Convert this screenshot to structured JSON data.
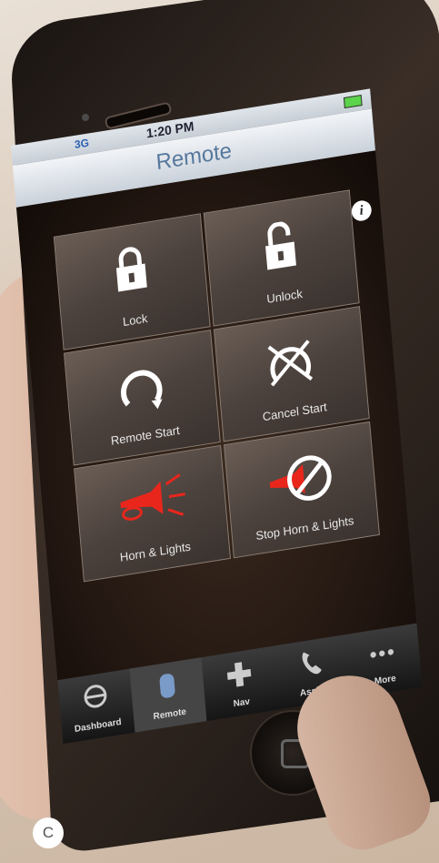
{
  "status": {
    "network": "3G",
    "time": "1:20 PM"
  },
  "nav": {
    "title": "Remote",
    "info_label": "i"
  },
  "tiles": [
    {
      "label": "Lock",
      "icon": "lock-icon"
    },
    {
      "label": "Unlock",
      "icon": "unlock-icon"
    },
    {
      "label": "Remote Start",
      "icon": "restart-arrow-icon"
    },
    {
      "label": "Cancel Start",
      "icon": "cancel-start-icon"
    },
    {
      "label": "Horn & Lights",
      "icon": "horn-icon"
    },
    {
      "label": "Stop Horn & Lights",
      "icon": "stop-horn-icon"
    }
  ],
  "tabs": [
    {
      "label": "Dashboard",
      "icon": "steering-wheel-icon"
    },
    {
      "label": "Remote",
      "icon": "key-fob-icon"
    },
    {
      "label": "Nav",
      "icon": "directional-pad-icon"
    },
    {
      "label": "Assist",
      "icon": "phone-icon"
    },
    {
      "label": "More",
      "icon": "more-dots-icon"
    }
  ],
  "badge": {
    "label": "C"
  },
  "colors": {
    "horn_red": "#e8261c",
    "title_blue": "#56789c",
    "tile": "#4c423d"
  }
}
